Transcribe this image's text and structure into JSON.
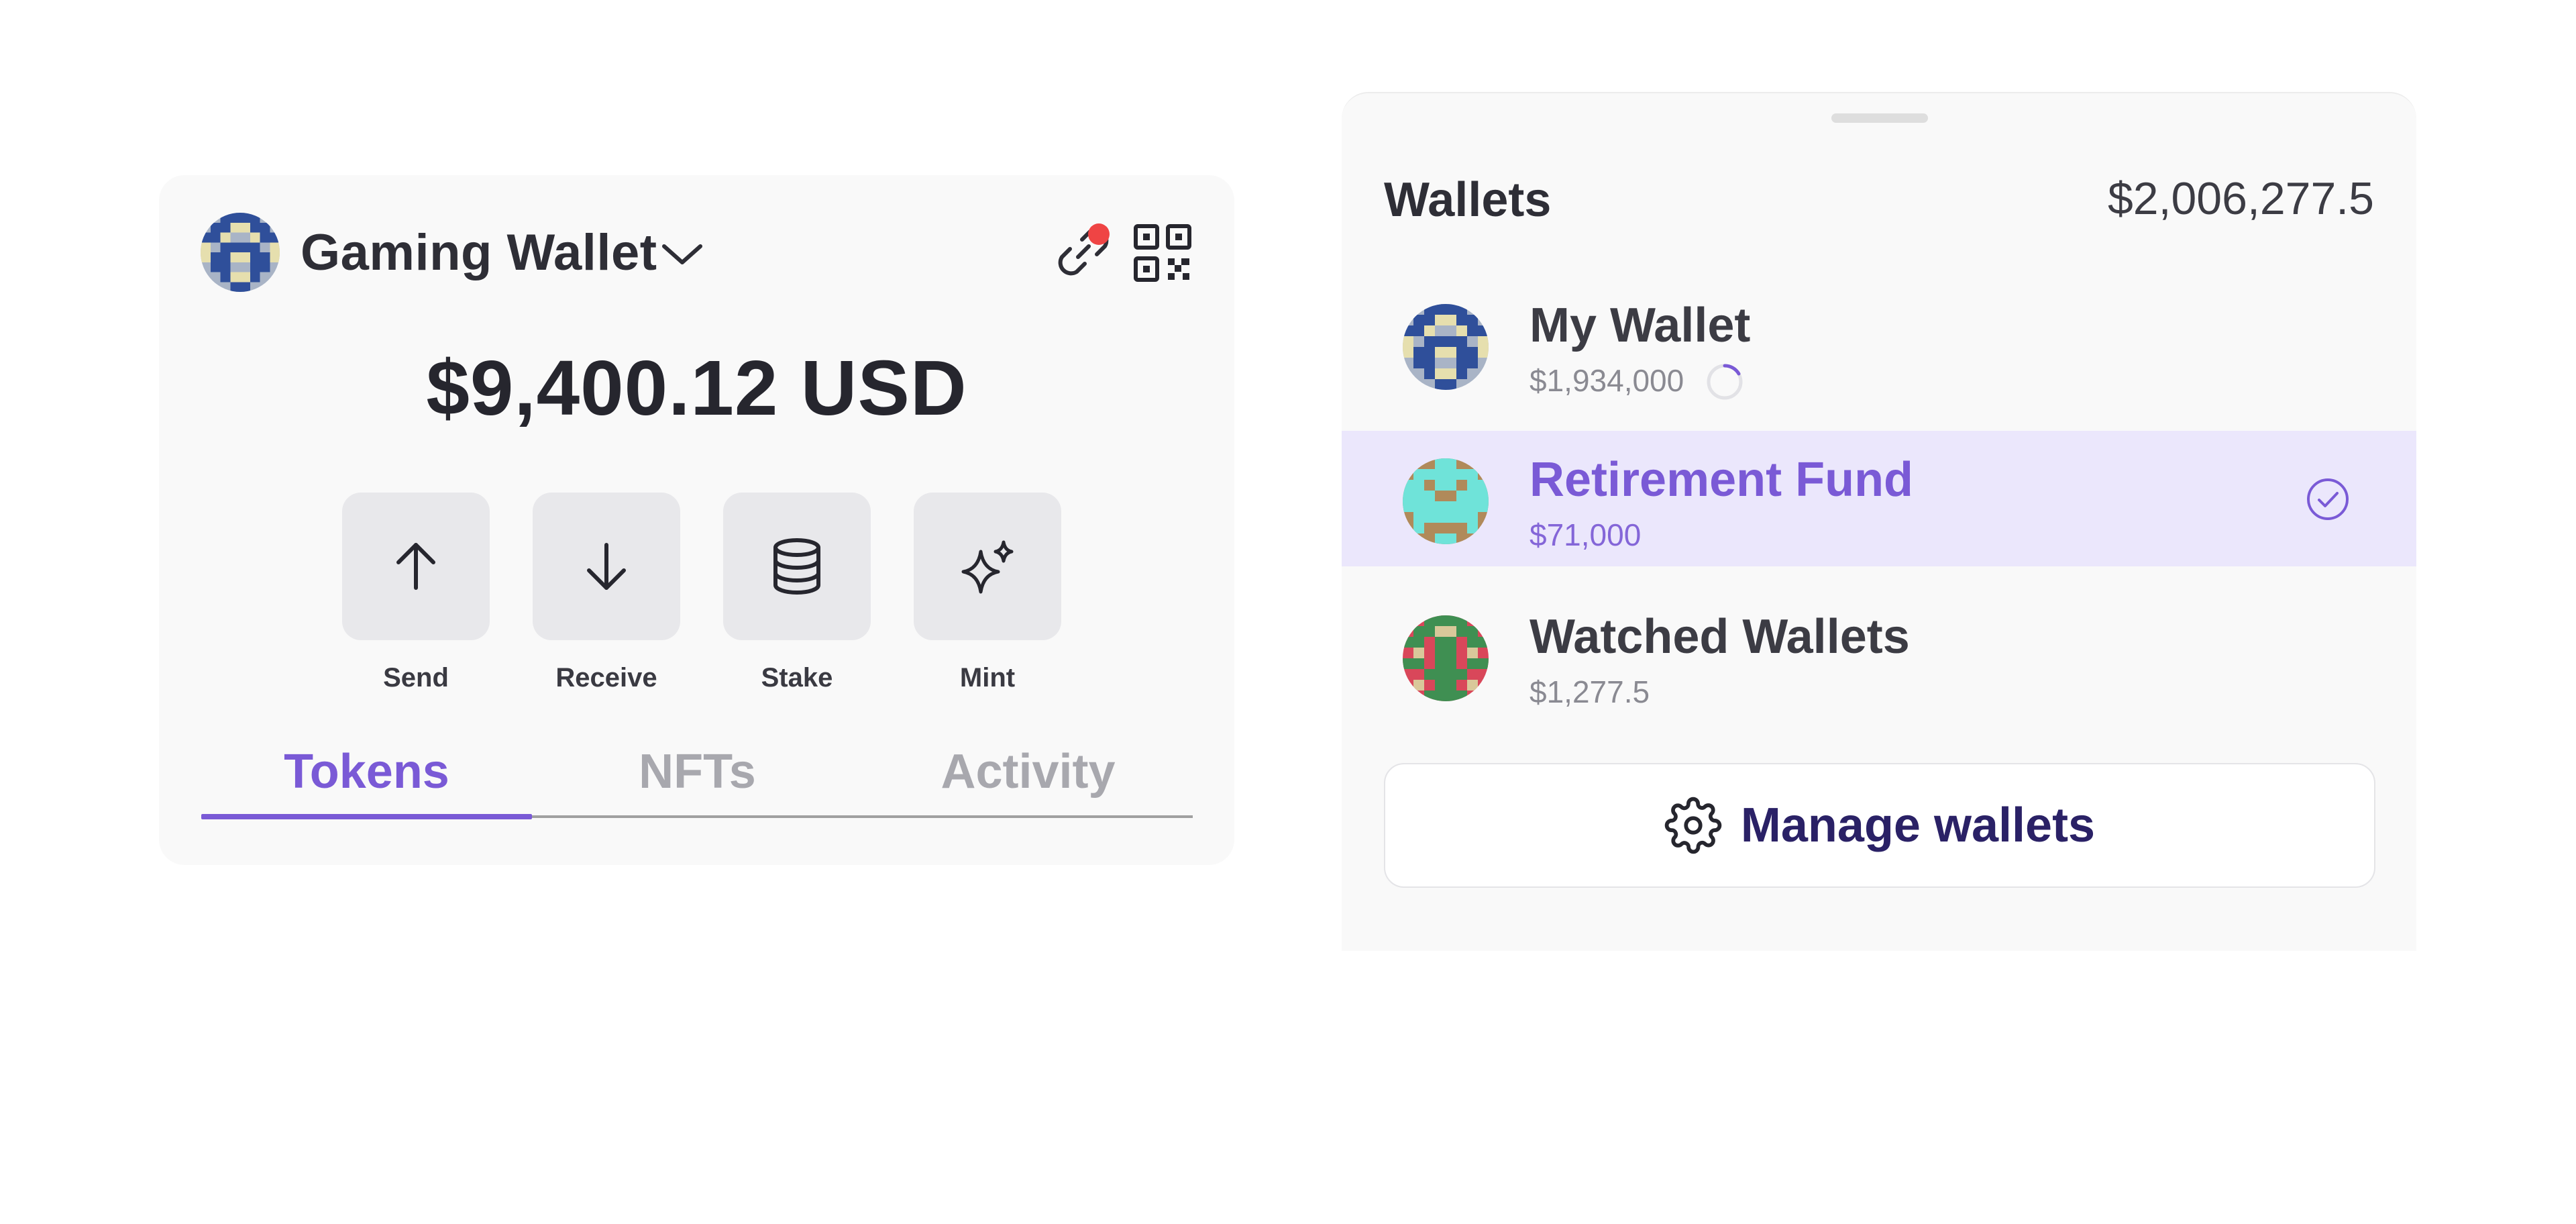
{
  "wallet_card": {
    "name": "Gaming Wallet",
    "balance": "$9,400.12 USD",
    "header_icons": [
      "chevron-down-icon",
      "link-icon",
      "qr-code-icon"
    ],
    "notification_color": "#ef4444",
    "actions": [
      {
        "label": "Send",
        "icon": "arrow-up-icon"
      },
      {
        "label": "Receive",
        "icon": "arrow-down-icon"
      },
      {
        "label": "Stake",
        "icon": "database-icon"
      },
      {
        "label": "Mint",
        "icon": "sparkles-icon"
      }
    ],
    "tabs": [
      {
        "label": "Tokens",
        "active": true
      },
      {
        "label": "NFTs",
        "active": false
      },
      {
        "label": "Activity",
        "active": false
      }
    ]
  },
  "wallets_panel": {
    "title": "Wallets",
    "total": "$2,006,277.5",
    "wallets": [
      {
        "name": "My Wallet",
        "amount": "$1,934,000",
        "loading": true,
        "selected": false
      },
      {
        "name": "Retirement Fund",
        "amount": "$71,000",
        "loading": false,
        "selected": true
      },
      {
        "name": "Watched Wallets",
        "amount": "$1,277.5",
        "loading": false,
        "selected": false
      }
    ],
    "manage_label": "Manage wallets",
    "manage_icon": "gear-icon"
  },
  "colors": {
    "accent": "#7a5ad6",
    "selected_row": "#ebe7fc",
    "manage_text": "#2a2166"
  }
}
